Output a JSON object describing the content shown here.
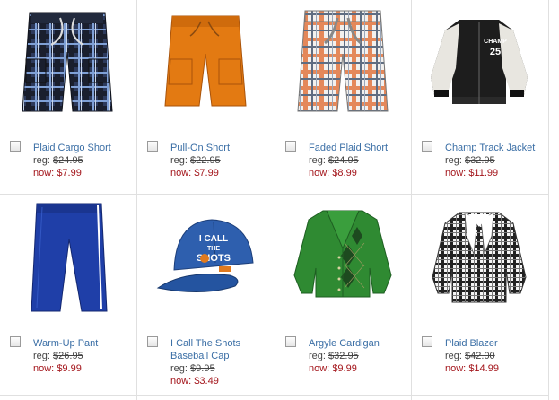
{
  "products": [
    {
      "name": "Plaid Cargo Short",
      "reg_label": "reg:",
      "reg_price": "$24.95",
      "now_label": "now:",
      "now_price": "$7.99",
      "image": "plaid-shorts"
    },
    {
      "name": "Pull-On Short",
      "reg_label": "reg:",
      "reg_price": "$22.95",
      "now_label": "now:",
      "now_price": "$7.99",
      "image": "orange-shorts"
    },
    {
      "name": "Faded Plaid Short",
      "reg_label": "reg:",
      "reg_price": "$24.95",
      "now_label": "now:",
      "now_price": "$8.99",
      "image": "faded-plaid-shorts"
    },
    {
      "name": "Champ Track Jacket",
      "reg_label": "reg:",
      "reg_price": "$32.95",
      "now_label": "now:",
      "now_price": "$11.99",
      "image": "track-jacket",
      "jacket_text_1": "CHAMP",
      "jacket_text_2": "25"
    },
    {
      "name": "Warm-Up Pant",
      "reg_label": "reg:",
      "reg_price": "$26.95",
      "now_label": "now:",
      "now_price": "$9.99",
      "image": "blue-pants"
    },
    {
      "name": "I Call The Shots",
      "name_line2": "Baseball Cap",
      "reg_label": "reg:",
      "reg_price": "$9.95",
      "now_label": "now:",
      "now_price": "$3.49",
      "image": "baseball-cap",
      "cap_text_1": "I CALL",
      "cap_text_2": "THE",
      "cap_text_3": "SHOTS"
    },
    {
      "name": "Argyle Cardigan",
      "reg_label": "reg:",
      "reg_price": "$32.95",
      "now_label": "now:",
      "now_price": "$9.99",
      "image": "green-cardigan"
    },
    {
      "name": "Plaid Blazer",
      "reg_label": "reg:",
      "reg_price": "$42.00",
      "now_label": "now:",
      "now_price": "$14.99",
      "image": "plaid-blazer"
    }
  ],
  "colors": {
    "link": "#3a6ea5",
    "sale": "#a3141a",
    "grid_line": "#e0e0e0"
  }
}
